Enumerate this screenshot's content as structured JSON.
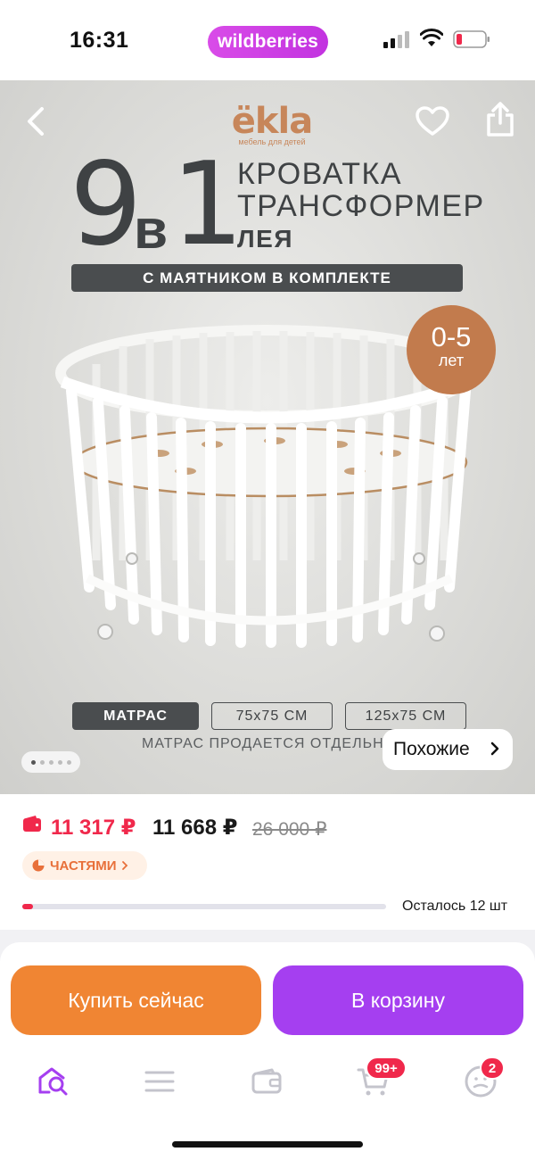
{
  "status_bar": {
    "time": "16:31",
    "app_brand": "wildberries"
  },
  "hero": {
    "brand_logo": "ёkla",
    "brand_tagline": "мебель для детей",
    "big_number_1": "9",
    "big_word": "в",
    "big_number_2": "1",
    "title_line_1": "КРОВАТКА",
    "title_line_2": "ТРАНСФОРМЕР",
    "title_line_3": "ЛЕЯ",
    "pendulum_label": "С МАЯТНИКОМ В КОМПЛЕКТЕ",
    "age_badge": {
      "value": "0-5",
      "unit": "лет"
    },
    "options": {
      "active": "МАТРАС",
      "size_1": "75х75 СМ",
      "size_2": "125х75 СМ"
    },
    "note": "МАТРАС ПРОДАЕТСЯ ОТДЕЛЬНО",
    "similar_button": "Похожие",
    "carousel": {
      "total": 5,
      "current": 1
    }
  },
  "price": {
    "wallet_price": "11 317 ₽",
    "regular_price": "11 668 ₽",
    "old_price": "26 000 ₽",
    "installment_label": "ЧАСТЯМИ",
    "stock_text": "Осталось 12 шт",
    "stock_fraction": 0.03
  },
  "actions": {
    "buy_now": "Купить сейчас",
    "add_to_cart": "В корзину"
  },
  "tabbar": {
    "cart_badge": "99+",
    "profile_badge": "2"
  },
  "colors": {
    "brand_purple": "#a53ff0",
    "buy_orange": "#f08533",
    "price_red": "#f0284b",
    "badge_copper": "#c27b4d"
  }
}
